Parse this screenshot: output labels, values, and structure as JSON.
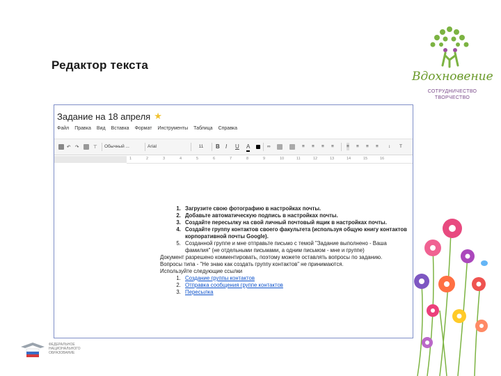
{
  "slide": {
    "title": "Редактор текста"
  },
  "logo": {
    "word": "Вдохновение",
    "line1": "СОТРУДНИЧЕСТВО",
    "line2": "ТВОРЧЕСТВО"
  },
  "doc": {
    "title": "Задание на 18 апреля",
    "menu": [
      "Файл",
      "Правка",
      "Вид",
      "Вставка",
      "Формат",
      "Инструменты",
      "Таблица",
      "Справка"
    ],
    "toolbar": {
      "style": "Обычный ...",
      "font": "Arial",
      "size": "11"
    },
    "ruler": [
      "1",
      "2",
      "3",
      "4",
      "5",
      "6",
      "7",
      "8",
      "9",
      "10",
      "11",
      "12",
      "13",
      "14",
      "15",
      "16"
    ],
    "tasks": [
      "Загрузите свою фотографию в настройках почты.",
      "Добавьте автоматическую подпись в настройках почты.",
      "Создайте пересылку на свой личный почтовый ящик в настройках почты.",
      "Создайте группу контактов своего факультета (используя общую книгу контактов корпоративной почты Google).",
      "Созданной группе и мне отправьте письмо с темой \"Задание выполнено - Ваша фамилия\" (не отдельными письмами, а одним письмом - мне и группе)"
    ],
    "note1": "Документ разрешено комментировать, поэтому можете оставлять вопросы по заданию.",
    "note2": "Вопросы типа - \"Не знаю как создать группу контактов\" не принимаются.",
    "note3": "Используйте следующие ссылки",
    "links": [
      "Создание группы контактов",
      "Отправка сообщения группе контактов",
      "Пересылка"
    ]
  },
  "footer": {
    "line1": "ФЕДЕРАЛЬНОЕ",
    "line2": "НАЦИОНАЛЬНОГО",
    "line3": "ОБРАЗОВАНИЕ"
  },
  "colors": {
    "accent_border": "#7f8fc8",
    "link": "#1155cc",
    "star": "#f1c232",
    "logo_green": "#6a9a2a"
  }
}
